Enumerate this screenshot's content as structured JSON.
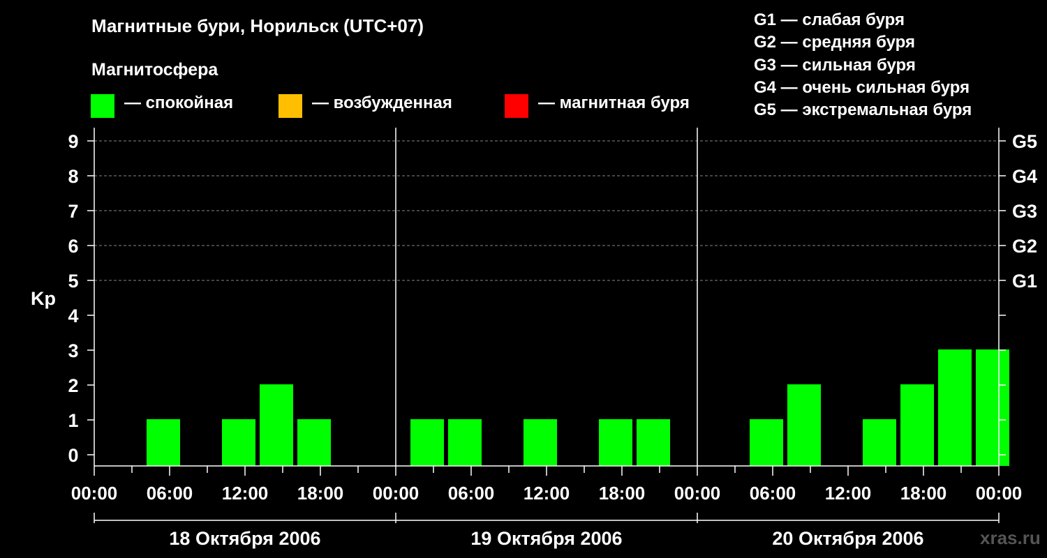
{
  "header": {
    "title": "Магнитные бури, Норильск (UTC+07)",
    "magnetosphere_title": "Магнитосфера"
  },
  "legend": [
    {
      "color": "#00ff00",
      "label": "— спокойная"
    },
    {
      "color": "#ffbf00",
      "label": "— возбужденная"
    },
    {
      "color": "#ff0000",
      "label": "— магнитная буря"
    }
  ],
  "g_scale": [
    "G1 — слабая буря",
    "G2 — средняя буря",
    "G3 — сильная буря",
    "G4 — очень сильная буря",
    "G5 — экстремальная буря"
  ],
  "footer": "xras.ru",
  "chart_data": {
    "type": "bar",
    "ylabel": "Kp",
    "ylim": [
      0,
      9
    ],
    "yticks": [
      "0",
      "1",
      "2",
      "3",
      "4",
      "5",
      "6",
      "7",
      "8",
      "9"
    ],
    "right_axis": [
      {
        "kp": 5,
        "label": "G1"
      },
      {
        "kp": 6,
        "label": "G2"
      },
      {
        "kp": 7,
        "label": "G3"
      },
      {
        "kp": 8,
        "label": "G4"
      },
      {
        "kp": 9,
        "label": "G5"
      }
    ],
    "xtick_labels": [
      "00:00",
      "06:00",
      "12:00",
      "18:00",
      "00:00",
      "06:00",
      "12:00",
      "18:00",
      "00:00",
      "06:00",
      "12:00",
      "18:00",
      "00:00"
    ],
    "days": [
      "18 Октября 2006",
      "19 Октября 2006",
      "20 Октября 2006"
    ],
    "bar_color": "#00ff00",
    "kp_values": [
      [
        0,
        1,
        0,
        1,
        2,
        1,
        0,
        0
      ],
      [
        1,
        1,
        0,
        1,
        0,
        1,
        1,
        0
      ],
      [
        0,
        1,
        2,
        0,
        1,
        2,
        3,
        3
      ]
    ],
    "grid": "dashed at Kp 5-9"
  }
}
